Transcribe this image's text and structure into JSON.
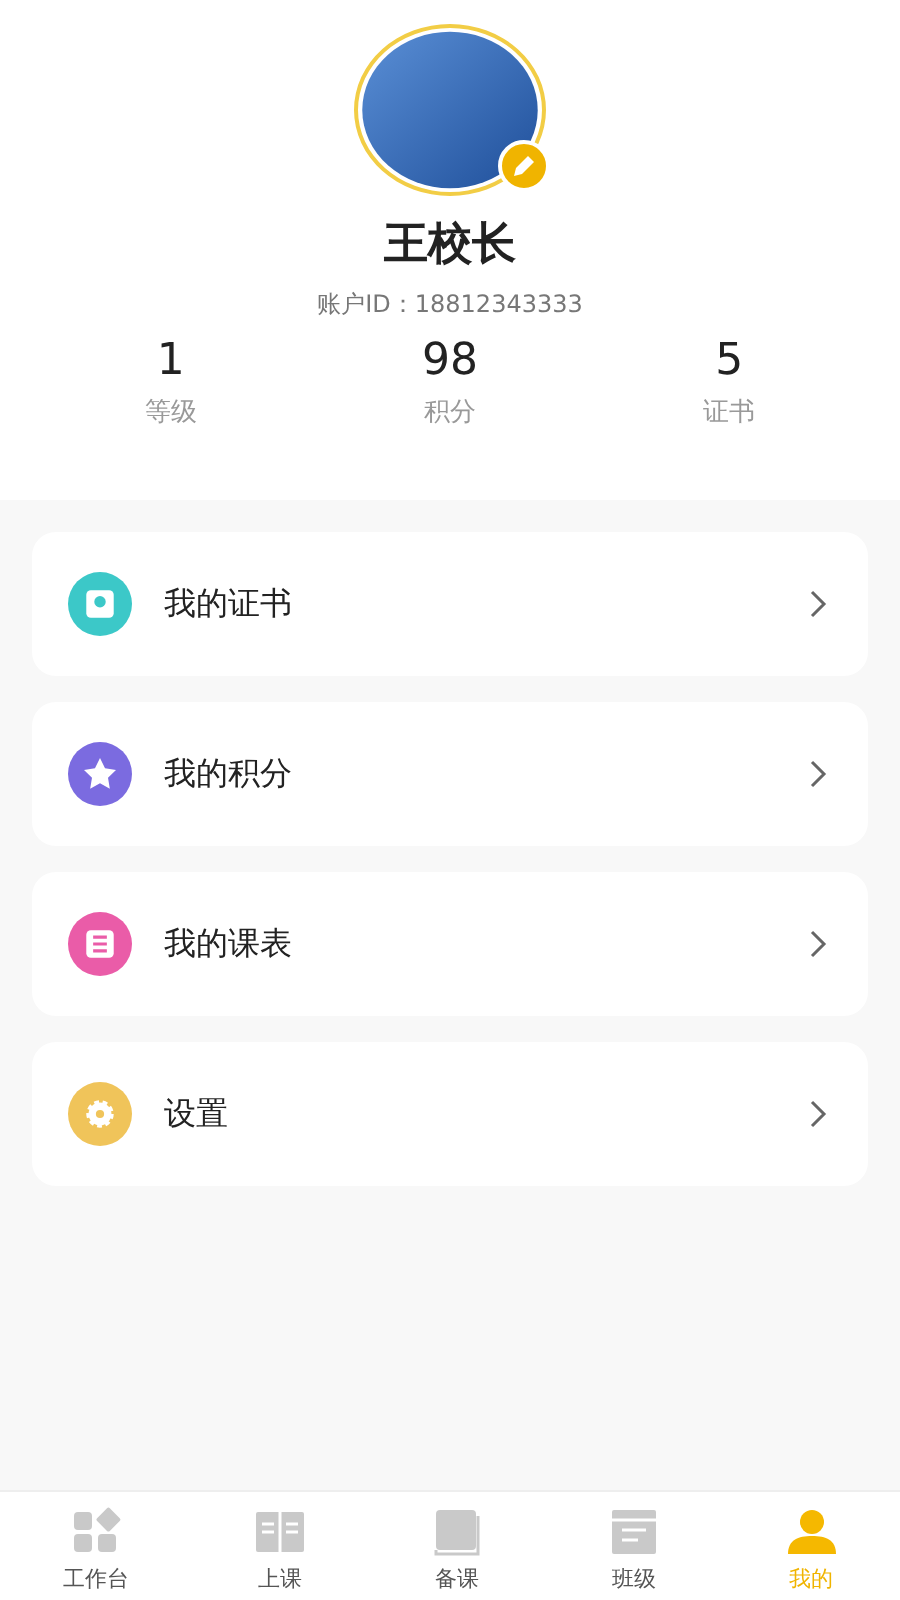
{
  "profile": {
    "name": "王校长",
    "account_id": "账户ID：18812343333"
  },
  "stats": [
    {
      "value": "1",
      "label": "等级"
    },
    {
      "value": "98",
      "label": "积分"
    },
    {
      "value": "5",
      "label": "证书"
    }
  ],
  "menu": [
    {
      "kind": "certificate",
      "label": "我的证书",
      "color": "#3cc8c8"
    },
    {
      "kind": "points",
      "label": "我的积分",
      "color": "#7b6be0"
    },
    {
      "kind": "schedule",
      "label": "我的课表",
      "color": "#ea5ca8"
    },
    {
      "kind": "settings",
      "label": "设置",
      "color": "#f0c45a"
    }
  ],
  "tabs": [
    {
      "kind": "workbench",
      "label": "工作台",
      "selected": false
    },
    {
      "kind": "class",
      "label": "上课",
      "selected": false
    },
    {
      "kind": "prepare",
      "label": "备课",
      "selected": false
    },
    {
      "kind": "grade",
      "label": "班级",
      "selected": false
    },
    {
      "kind": "mine",
      "label": "我的",
      "selected": true
    }
  ]
}
